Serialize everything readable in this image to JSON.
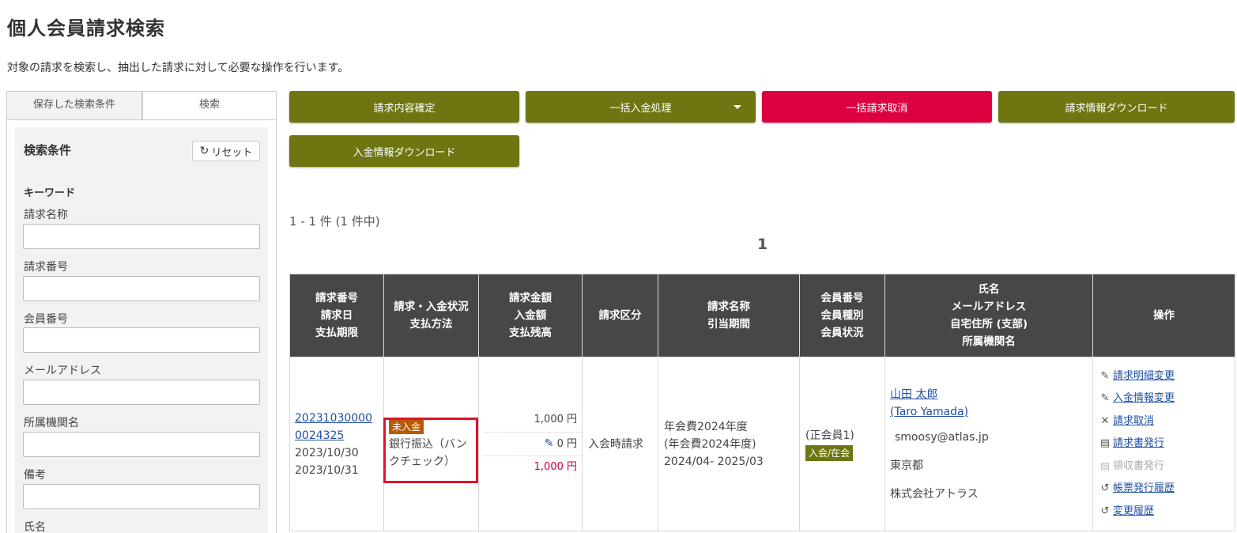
{
  "page": {
    "title": "個人会員請求検索",
    "description": "対象の請求を検索し、抽出した請求に対して必要な操作を行います。"
  },
  "sidebar": {
    "tabs": [
      "保存した検索条件",
      "検索"
    ],
    "panel_title": "検索条件",
    "reset_label": "リセット",
    "keyword_heading": "キーワード",
    "fields": [
      {
        "label": "請求名称",
        "value": ""
      },
      {
        "label": "請求番号",
        "value": ""
      },
      {
        "label": "会員番号",
        "value": ""
      },
      {
        "label": "メールアドレス",
        "value": ""
      },
      {
        "label": "所属機関名",
        "value": ""
      },
      {
        "label": "備考",
        "value": ""
      },
      {
        "label": "氏名",
        "value": ""
      }
    ]
  },
  "toolbar": {
    "confirm": "請求内容確定",
    "bulk_payment": "一括入金処理",
    "bulk_cancel": "一括請求取消",
    "invoice_download": "請求情報ダウンロード",
    "payment_download": "入金情報ダウンロード"
  },
  "results": {
    "count_text": "1 - 1 件 (1 件中)",
    "page": "1"
  },
  "table": {
    "headers": [
      [
        "請求番号",
        "請求日",
        "支払期限"
      ],
      [
        "請求・入金状況",
        "支払方法"
      ],
      [
        "請求金額",
        "入金額",
        "支払残高"
      ],
      [
        "請求区分"
      ],
      [
        "請求名称",
        "引当期間"
      ],
      [
        "会員番号",
        "会員種別",
        "会員状況"
      ],
      [
        "氏名",
        "メールアドレス",
        "自宅住所 (支部)",
        "所属機関名"
      ],
      [
        "操作"
      ]
    ],
    "row": {
      "invoice_no_line1": "20231030000",
      "invoice_no_line2": "0024325",
      "invoice_date": "2023/10/30",
      "due_date": "2023/10/31",
      "status_badge": "未入金",
      "payment_method": "銀行振込（バンクチェック）",
      "billed_amount": "1,000 円",
      "paid_amount": "0 円",
      "balance": "1,000 円",
      "category": "入会時請求",
      "name_line1": "年会費2024年度",
      "name_line2": "(年会費2024年度)",
      "period": "2024/04- 2025/03",
      "member_type": "(正会員1)",
      "member_status": "入会/在会",
      "person_name": "山田 太郎",
      "person_name_en": "(Taro Yamada)",
      "email": "smoosy@atlas.jp",
      "address": "東京都",
      "org": "株式会社アトラス",
      "ops": [
        {
          "label": "請求明細変更",
          "icon": "pencil-icon",
          "enabled": true
        },
        {
          "label": "入金情報変更",
          "icon": "pencil-icon",
          "enabled": true
        },
        {
          "label": "請求取消",
          "icon": "cross-icon",
          "enabled": true
        },
        {
          "label": "請求書発行",
          "icon": "document-icon",
          "enabled": true
        },
        {
          "label": "領収書発行",
          "icon": "document-icon",
          "enabled": false
        },
        {
          "label": "帳票発行履歴",
          "icon": "history-icon",
          "enabled": true
        },
        {
          "label": "変更履歴",
          "icon": "history-icon",
          "enabled": true
        }
      ]
    }
  },
  "colors": {
    "olive": "#6e7511",
    "red": "#dd0040",
    "header_bg": "#474747",
    "highlight_box": "#e1112b",
    "unpaid_badge": "#b85a07",
    "link": "#1f4fa5",
    "balance_red": "#c0003c"
  }
}
